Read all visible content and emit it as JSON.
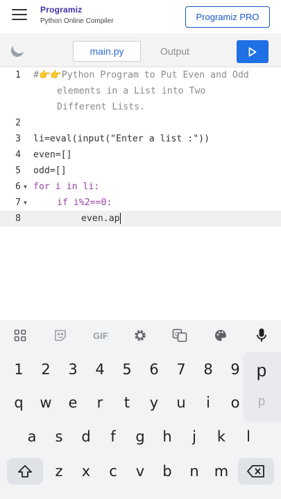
{
  "header": {
    "logo_text": "Programiz",
    "subtitle": "Python Online Compiler",
    "pro_button": "Programiz PRO"
  },
  "toolbar": {
    "tabs": [
      {
        "label": "main.py",
        "active": true
      },
      {
        "label": "Output",
        "active": false
      }
    ],
    "theme_icon": "moon-icon",
    "run_icon": "play-icon"
  },
  "editor": {
    "active_line": 8,
    "lines": [
      {
        "num": "1",
        "text": "#👉👉Python Program to Put Even and Odd"
      },
      {
        "num": "",
        "text": "elements in a List into Two"
      },
      {
        "num": "",
        "text": "Different Lists."
      },
      {
        "num": "2",
        "text": ""
      },
      {
        "num": "3",
        "text": "li=eval(input(\"Enter a list :\"))"
      },
      {
        "num": "4",
        "text": "even=[]"
      },
      {
        "num": "5",
        "text": "odd=[]"
      },
      {
        "num": "6",
        "text": "for i in li:"
      },
      {
        "num": "7",
        "text": "if i%2==0:"
      },
      {
        "num": "8",
        "text": "even.ap"
      }
    ]
  },
  "keyboard": {
    "toolbar_icons": [
      "apps-icon",
      "sticker-icon",
      "gif-icon",
      "settings-icon",
      "translate-icon",
      "palette-icon",
      "mic-icon"
    ],
    "gif_label": "GIF",
    "number_row": [
      "1",
      "2",
      "3",
      "4",
      "5",
      "6",
      "7",
      "8",
      "9"
    ],
    "row1": [
      "q",
      "w",
      "e",
      "r",
      "t",
      "y",
      "u",
      "i",
      "o"
    ],
    "row2": [
      "a",
      "s",
      "d",
      "f",
      "g",
      "h",
      "j",
      "k",
      "l"
    ],
    "row3": [
      "z",
      "x",
      "c",
      "v",
      "b",
      "n",
      "m"
    ],
    "popup_key": "p",
    "popup_ghost": "p"
  },
  "colors": {
    "accent": "#1f6fe5",
    "brand": "#3b2fa8",
    "keyword": "#9b3fa9",
    "string": "#2a8f3a",
    "comment": "#8a8a8a"
  }
}
